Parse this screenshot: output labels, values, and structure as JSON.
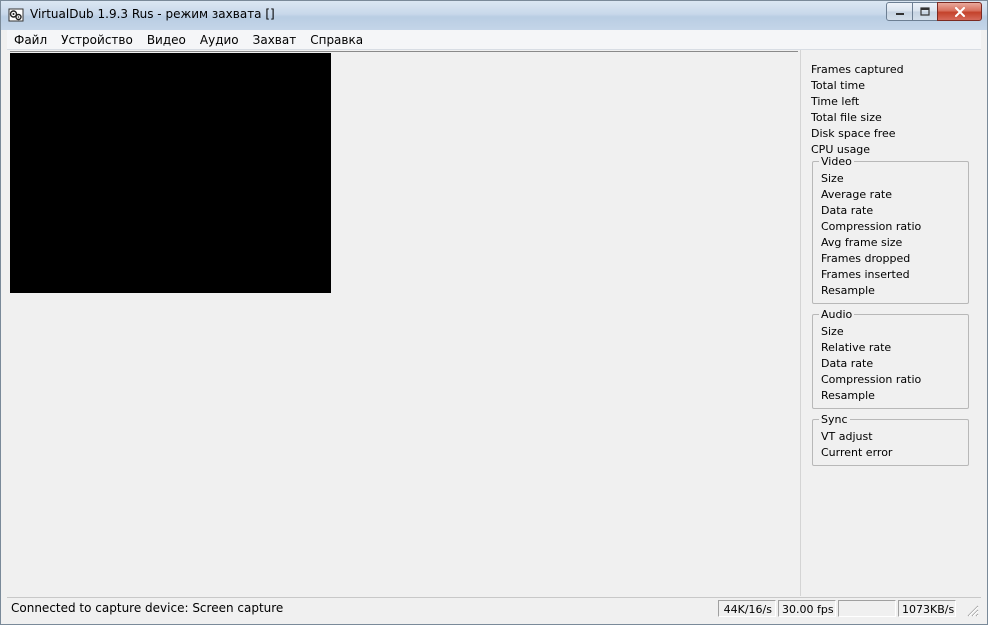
{
  "window": {
    "title": "VirtualDub 1.9.3 Rus - режим захвата []",
    "icon": "film-gears-icon"
  },
  "menu": {
    "items": [
      "Файл",
      "Устройство",
      "Видео",
      "Аудио",
      "Захват",
      "Справка"
    ]
  },
  "stats": {
    "general": [
      "Frames captured",
      "Total time",
      "Time left",
      "Total file size",
      "Disk space free",
      "CPU usage"
    ],
    "video": {
      "title": "Video",
      "items": [
        "Size",
        "Average rate",
        "Data rate",
        "Compression ratio",
        "Avg frame size",
        "Frames dropped",
        "Frames inserted",
        "Resample"
      ]
    },
    "audio": {
      "title": "Audio",
      "items": [
        "Size",
        "Relative rate",
        "Data rate",
        "Compression ratio",
        "Resample"
      ]
    },
    "sync": {
      "title": "Sync",
      "items": [
        "VT adjust",
        "Current error"
      ]
    }
  },
  "statusbar": {
    "message": "Connected to capture device: Screen capture",
    "audio_format": "44K/16/s",
    "fps": "30.00 fps",
    "blank": "",
    "rate": "1073KB/s"
  },
  "colors": {
    "preview": "#000000",
    "background": "#f0f0f0",
    "close_button": "#c4422b"
  }
}
